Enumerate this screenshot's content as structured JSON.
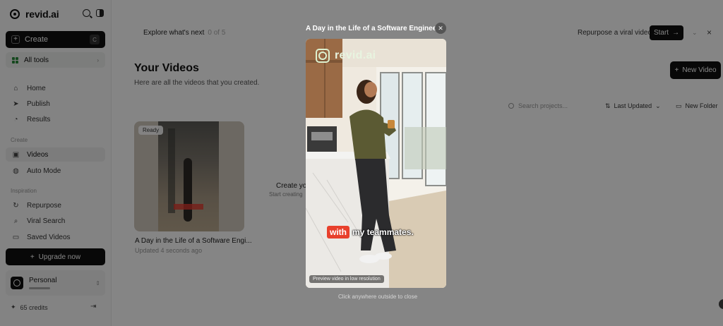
{
  "brand": {
    "name": "revid.ai"
  },
  "sidebar": {
    "create_label": "Create",
    "create_shortcut": "C",
    "all_tools_label": "All tools",
    "main_items": [
      {
        "label": "Home",
        "icon": "home-icon"
      },
      {
        "label": "Publish",
        "icon": "send-icon"
      },
      {
        "label": "Results",
        "icon": "chart-icon"
      }
    ],
    "create_section": "Create",
    "create_items": [
      {
        "label": "Videos",
        "icon": "video-icon",
        "active": true
      },
      {
        "label": "Auto Mode",
        "icon": "auto-icon"
      }
    ],
    "inspiration_section": "Inspiration",
    "inspiration_items": [
      {
        "label": "Repurpose",
        "icon": "refresh-icon"
      },
      {
        "label": "Viral Search",
        "icon": "search-icon"
      },
      {
        "label": "Saved Videos",
        "icon": "bookmark-icon"
      }
    ],
    "upgrade_label": "Upgrade now",
    "account_name": "Personal",
    "credits": "65 credits"
  },
  "topbar": {
    "explore_label": "Explore what's next",
    "explore_progress": "0 of 5",
    "repurpose_label": "Repurpose a viral video",
    "start_label": "Start"
  },
  "main": {
    "title": "Your Videos",
    "subtitle": "Here are all the videos that you created.",
    "new_video_label": "New Video",
    "search_placeholder": "Search projects...",
    "sort_label": "Last Updated",
    "new_folder_label": "New Folder",
    "create_card_title": "Create you",
    "create_card_sub": "Start creating",
    "videos": [
      {
        "status": "Ready",
        "title": "A Day in the Life of a Software Engi...",
        "updated": "Updated 4 seconds ago"
      }
    ]
  },
  "modal": {
    "title": "A Day in the Life of a Software Engineer",
    "watermark": "revid.ai",
    "subtitle_highlight": "with",
    "subtitle_rest": "my teammates.",
    "preview_note": "Preview video in low resolution",
    "click_outside": "Click anywhere outside to close"
  },
  "colors": {
    "accent": "#111111",
    "caption_highlight": "#e8402c",
    "brand_green": "#2a8a3a"
  }
}
